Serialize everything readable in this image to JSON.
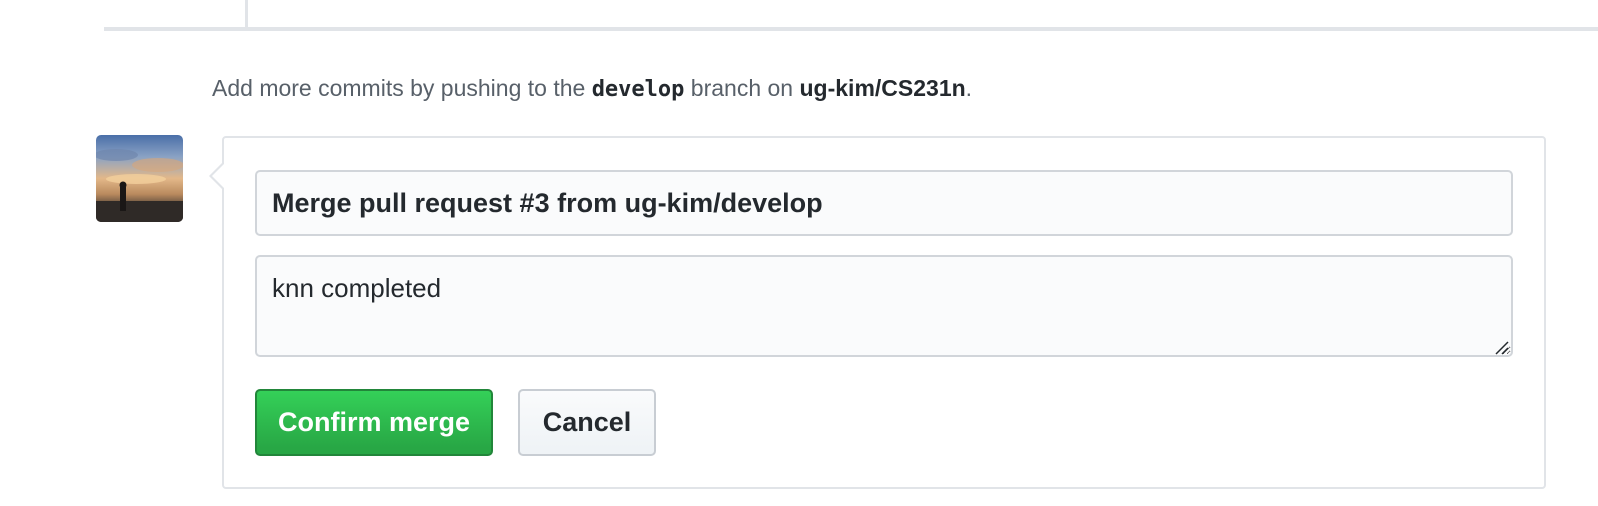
{
  "hint": {
    "prefix": "Add more commits by pushing to the ",
    "branch": "develop",
    "middle": " branch on ",
    "repo": "ug-kim/CS231n",
    "suffix": "."
  },
  "merge_form": {
    "title_value": "Merge pull request #3 from ug-kim/develop",
    "body_value": "knn completed",
    "confirm_label": "Confirm merge",
    "cancel_label": "Cancel"
  },
  "icons": {
    "avatar": "user-avatar",
    "resize": "resize-grip-icon"
  },
  "colors": {
    "confirm_green": "#2ea44f",
    "border": "#e1e4e8",
    "text_muted": "#586069"
  }
}
